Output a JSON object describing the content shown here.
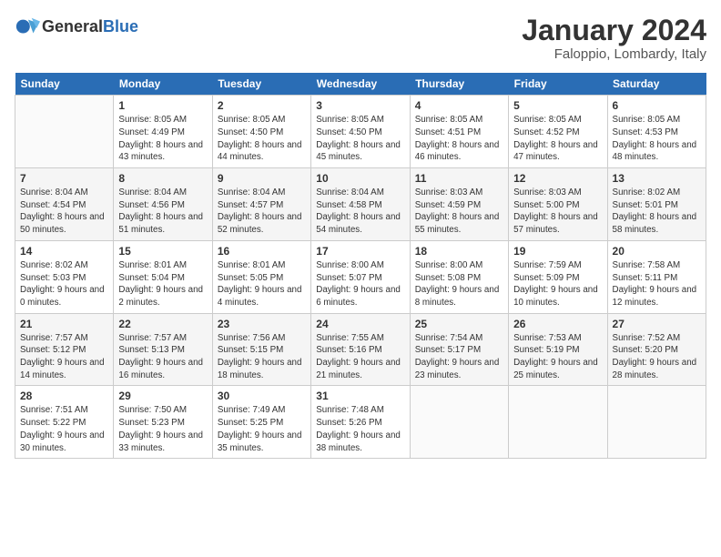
{
  "logo": {
    "line1": "General",
    "line2": "Blue"
  },
  "title": "January 2024",
  "subtitle": "Faloppio, Lombardy, Italy",
  "weekdays": [
    "Sunday",
    "Monday",
    "Tuesday",
    "Wednesday",
    "Thursday",
    "Friday",
    "Saturday"
  ],
  "weeks": [
    [
      {
        "day": "",
        "info": ""
      },
      {
        "day": "1",
        "info": "Sunrise: 8:05 AM\nSunset: 4:49 PM\nDaylight: 8 hours\nand 43 minutes."
      },
      {
        "day": "2",
        "info": "Sunrise: 8:05 AM\nSunset: 4:50 PM\nDaylight: 8 hours\nand 44 minutes."
      },
      {
        "day": "3",
        "info": "Sunrise: 8:05 AM\nSunset: 4:50 PM\nDaylight: 8 hours\nand 45 minutes."
      },
      {
        "day": "4",
        "info": "Sunrise: 8:05 AM\nSunset: 4:51 PM\nDaylight: 8 hours\nand 46 minutes."
      },
      {
        "day": "5",
        "info": "Sunrise: 8:05 AM\nSunset: 4:52 PM\nDaylight: 8 hours\nand 47 minutes."
      },
      {
        "day": "6",
        "info": "Sunrise: 8:05 AM\nSunset: 4:53 PM\nDaylight: 8 hours\nand 48 minutes."
      }
    ],
    [
      {
        "day": "7",
        "info": "Sunrise: 8:04 AM\nSunset: 4:54 PM\nDaylight: 8 hours\nand 50 minutes."
      },
      {
        "day": "8",
        "info": "Sunrise: 8:04 AM\nSunset: 4:56 PM\nDaylight: 8 hours\nand 51 minutes."
      },
      {
        "day": "9",
        "info": "Sunrise: 8:04 AM\nSunset: 4:57 PM\nDaylight: 8 hours\nand 52 minutes."
      },
      {
        "day": "10",
        "info": "Sunrise: 8:04 AM\nSunset: 4:58 PM\nDaylight: 8 hours\nand 54 minutes."
      },
      {
        "day": "11",
        "info": "Sunrise: 8:03 AM\nSunset: 4:59 PM\nDaylight: 8 hours\nand 55 minutes."
      },
      {
        "day": "12",
        "info": "Sunrise: 8:03 AM\nSunset: 5:00 PM\nDaylight: 8 hours\nand 57 minutes."
      },
      {
        "day": "13",
        "info": "Sunrise: 8:02 AM\nSunset: 5:01 PM\nDaylight: 8 hours\nand 58 minutes."
      }
    ],
    [
      {
        "day": "14",
        "info": "Sunrise: 8:02 AM\nSunset: 5:03 PM\nDaylight: 9 hours\nand 0 minutes."
      },
      {
        "day": "15",
        "info": "Sunrise: 8:01 AM\nSunset: 5:04 PM\nDaylight: 9 hours\nand 2 minutes."
      },
      {
        "day": "16",
        "info": "Sunrise: 8:01 AM\nSunset: 5:05 PM\nDaylight: 9 hours\nand 4 minutes."
      },
      {
        "day": "17",
        "info": "Sunrise: 8:00 AM\nSunset: 5:07 PM\nDaylight: 9 hours\nand 6 minutes."
      },
      {
        "day": "18",
        "info": "Sunrise: 8:00 AM\nSunset: 5:08 PM\nDaylight: 9 hours\nand 8 minutes."
      },
      {
        "day": "19",
        "info": "Sunrise: 7:59 AM\nSunset: 5:09 PM\nDaylight: 9 hours\nand 10 minutes."
      },
      {
        "day": "20",
        "info": "Sunrise: 7:58 AM\nSunset: 5:11 PM\nDaylight: 9 hours\nand 12 minutes."
      }
    ],
    [
      {
        "day": "21",
        "info": "Sunrise: 7:57 AM\nSunset: 5:12 PM\nDaylight: 9 hours\nand 14 minutes."
      },
      {
        "day": "22",
        "info": "Sunrise: 7:57 AM\nSunset: 5:13 PM\nDaylight: 9 hours\nand 16 minutes."
      },
      {
        "day": "23",
        "info": "Sunrise: 7:56 AM\nSunset: 5:15 PM\nDaylight: 9 hours\nand 18 minutes."
      },
      {
        "day": "24",
        "info": "Sunrise: 7:55 AM\nSunset: 5:16 PM\nDaylight: 9 hours\nand 21 minutes."
      },
      {
        "day": "25",
        "info": "Sunrise: 7:54 AM\nSunset: 5:17 PM\nDaylight: 9 hours\nand 23 minutes."
      },
      {
        "day": "26",
        "info": "Sunrise: 7:53 AM\nSunset: 5:19 PM\nDaylight: 9 hours\nand 25 minutes."
      },
      {
        "day": "27",
        "info": "Sunrise: 7:52 AM\nSunset: 5:20 PM\nDaylight: 9 hours\nand 28 minutes."
      }
    ],
    [
      {
        "day": "28",
        "info": "Sunrise: 7:51 AM\nSunset: 5:22 PM\nDaylight: 9 hours\nand 30 minutes."
      },
      {
        "day": "29",
        "info": "Sunrise: 7:50 AM\nSunset: 5:23 PM\nDaylight: 9 hours\nand 33 minutes."
      },
      {
        "day": "30",
        "info": "Sunrise: 7:49 AM\nSunset: 5:25 PM\nDaylight: 9 hours\nand 35 minutes."
      },
      {
        "day": "31",
        "info": "Sunrise: 7:48 AM\nSunset: 5:26 PM\nDaylight: 9 hours\nand 38 minutes."
      },
      {
        "day": "",
        "info": ""
      },
      {
        "day": "",
        "info": ""
      },
      {
        "day": "",
        "info": ""
      }
    ]
  ]
}
